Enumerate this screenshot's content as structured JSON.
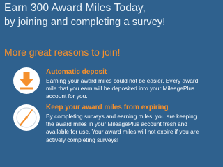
{
  "header": {
    "title_line1": "Earn 300 Award Miles Today,",
    "title_line2": "by joining and completing a survey!"
  },
  "reasons": {
    "heading": "More great reasons to join!",
    "items": [
      {
        "icon": "download-arrow-icon",
        "title": "Automatic deposit",
        "description": "Earning your award miles could not be easier. Every award mile that you earn will be deposited into your MileagePlus account for you."
      },
      {
        "icon": "clock-icon",
        "title": "Keep your award miles from expiring",
        "description": "By completing surveys and earning miles, you are keeping the award miles in your MileagePlus account fresh and available for use. Your award miles will not expire if you are actively completing surveys!"
      }
    ]
  },
  "colors": {
    "background": "#2f618e",
    "accent": "#f5902d",
    "text": "#ffffff"
  }
}
